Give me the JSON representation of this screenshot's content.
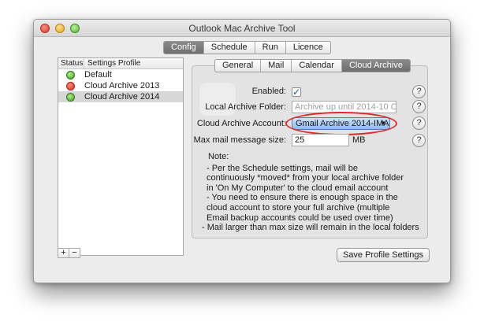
{
  "window": {
    "title": "Outlook Mac Archive Tool"
  },
  "main_tabs": [
    {
      "label": "Config",
      "active": true
    },
    {
      "label": "Schedule",
      "active": false
    },
    {
      "label": "Run",
      "active": false
    },
    {
      "label": "Licence",
      "active": false
    }
  ],
  "profiles": {
    "header_status": "Status",
    "header_profile": "Settings Profile",
    "rows": [
      {
        "status": "green",
        "name": "Default"
      },
      {
        "status": "red",
        "name": "Cloud Archive 2013"
      },
      {
        "status": "green",
        "name": "Cloud Archive 2014",
        "selected": true
      }
    ],
    "add_label": "+",
    "remove_label": "−"
  },
  "sub_tabs": [
    {
      "label": "General",
      "active": false
    },
    {
      "label": "Mail",
      "active": false
    },
    {
      "label": "Calendar",
      "active": false
    },
    {
      "label": "Cloud Archive",
      "active": true
    }
  ],
  "form": {
    "enabled_label": "Enabled:",
    "enabled_checked": true,
    "enabled_mark": "✓",
    "local_folder_label": "Local Archive Folder:",
    "local_folder_placeholder": "Archive up until 2014-10 C",
    "cloud_account_label": "Cloud Archive Account:",
    "cloud_account_value": "Gmail Archive 2014-IMA",
    "max_size_label": "Max mail message size:",
    "max_size_value": "25",
    "max_size_unit": "MB",
    "help_label": "?"
  },
  "notes": {
    "title": "Note:",
    "lines": [
      " - Per the Schedule settings, mail will be",
      "continuously *moved* from your local archive folder",
      "in 'On My Computer' to the cloud email account",
      " - You need to ensure there is enough space in the",
      "cloud account to store your full archive (multiple",
      "Email backup accounts could be used over time)",
      "- Mail larger than max size will remain in the local folders"
    ]
  },
  "save_button_label": "Save Profile Settings",
  "colors": {
    "accent": "#4a7bc4",
    "highlight_ellipse": "#e02828",
    "status_green": "#3e9a24",
    "status_red": "#d23220"
  }
}
